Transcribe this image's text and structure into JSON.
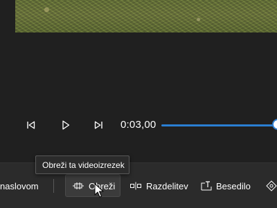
{
  "player": {
    "current_time": "0:03,00",
    "progress": 1.0,
    "icons": {
      "previous_frame": "skip-back-icon",
      "play": "play-icon",
      "next_frame": "skip-forward-icon"
    }
  },
  "toolbar": {
    "title_card_partial": "naslovom",
    "trim_label": "Obreži",
    "split_label": "Razdelitev",
    "text_label": "Besedilo"
  },
  "tooltip": {
    "text": "Obreži ta videoizrezek"
  },
  "colors": {
    "background": "#202020",
    "toolbar": "#2b2b2b",
    "accent": "#2a7fd4"
  }
}
